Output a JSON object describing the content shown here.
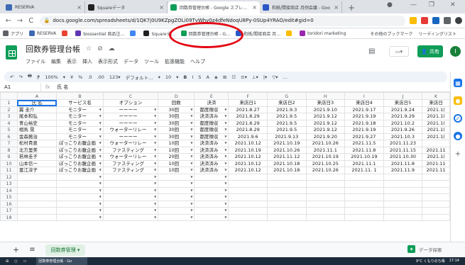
{
  "browser": {
    "tabs": [
      {
        "label": "RESERVA",
        "color": "#3d6ab3"
      },
      {
        "label": "Squareデータ",
        "color": "#222222"
      },
      {
        "label": "回数券管理台帳 - Google スプレッドシート",
        "color": "#0f9d58",
        "active": true
      },
      {
        "label": "和紙/間接商店 月例会議 - Goo",
        "color": "#2a56c6"
      }
    ],
    "new_tab": "+",
    "address": "docs.google.com/spreadsheets/d/1QK7j0U9KZpgZOLi09TvWhv0z4dfeNdoqU8Py-0SUp4YRAO/edit#gid=0",
    "bookmarks": [
      {
        "label": "アプリ",
        "color": "#5f6368"
      },
      {
        "label": "RESERVA",
        "color": "#3d6ab3"
      },
      {
        "label": "",
        "color": "#ea4335"
      },
      {
        "label": "biossentiel 商品注…",
        "color": "#5e35b1"
      },
      {
        "label": "",
        "color": "#4285f4"
      },
      {
        "label": "Squareデ…",
        "color": "#222222"
      },
      {
        "label": "回数券管理台帳 - G…",
        "color": "#0f9d58"
      },
      {
        "label": "和紙/間接商店 月…",
        "color": "#2a56c6"
      },
      {
        "label": "",
        "color": "#fbbc04"
      },
      {
        "label": "toridori marketing",
        "color": "#9c27b0"
      }
    ],
    "bookmarks_right": [
      "その他のブックマーク",
      "リーディングリスト"
    ]
  },
  "doc": {
    "title": "回数券管理台帳",
    "title_icons": [
      "☆",
      "⊘",
      "☁"
    ],
    "menu": [
      "ファイル",
      "編集",
      "表示",
      "挿入",
      "表示形式",
      "データ",
      "ツール",
      "拡張機能",
      "ヘルプ"
    ],
    "share_label": "共有",
    "avatar_letter": "I",
    "present_label": "▭▾"
  },
  "toolbar": {
    "items": [
      "↶",
      "↷",
      "🖶",
      "⁋",
      "100%",
      "▾",
      "¥",
      "%",
      ".0",
      ".00",
      "123▾",
      "デフォルト…",
      "▾",
      "10",
      "▾"
    ],
    "bold": "B",
    "items2": [
      "I",
      "S",
      "A",
      "◈",
      "⊞",
      "☷",
      "≡▾",
      "⊥▾",
      "|▾",
      "▽▾",
      "…"
    ],
    "collapse": "^"
  },
  "formula": {
    "cell_ref": "A1",
    "fx": "fx",
    "content": "氏 名"
  },
  "grid": {
    "columns": [
      "A",
      "B",
      "C",
      "D",
      "E",
      "F",
      "G",
      "H",
      "I",
      "J",
      "K"
    ],
    "rows": [
      [
        "氏 名",
        "サービス名",
        "オプション",
        "回数",
        "決済",
        "来店日1",
        "来店日2",
        "来店日3",
        "来店日4",
        "来店日5",
        "来店日"
      ],
      [
        "翼 圭介",
        "モニター",
        "ーーーー",
        "30回",
        "都度徴収",
        "2021.8.27",
        "2021.9.3",
        "2021.9.10",
        "2021.9.17",
        "2021.9.24",
        "2021.1("
      ],
      [
        "尾本和弘",
        "モニター",
        "ーーーー",
        "30回",
        "決済済み",
        "2021.8.29",
        "2021.9.5",
        "2021.9.12",
        "2021.9.19",
        "2021.9.29",
        "2021.1("
      ],
      [
        "青山裕史",
        "モニター",
        "ーーーー",
        "30回",
        "都度徴収",
        "2021.8.29",
        "2021.9.5",
        "2021.9.12",
        "2021.9.18",
        "2021.10.2",
        "2021.1("
      ],
      [
        "相馬 晃",
        "モニター",
        "ウォーターリレー",
        "30回",
        "都度徴収",
        "2021.8.29",
        "2021.9.5",
        "2021.9.12",
        "2021.9.19",
        "2021.9.26",
        "2021.1("
      ],
      [
        "金森醤治",
        "モニター",
        "ーーーー",
        "30回",
        "都度徴収",
        "2021.9.6",
        "2021.9.13",
        "2021.9.20",
        "2021.9.27",
        "2021.10.3",
        "2021.1("
      ],
      [
        "松村貴恵",
        "ぽっこりお腹企画",
        "ウォーターリレー",
        "10回",
        "決済済み",
        "2021.10.12",
        "2021.10.19",
        "2021.10.26",
        "2021.11.5",
        "2021.11.23",
        ""
      ],
      [
        "北方里美",
        "ぽっこりお腹企画",
        "ファスティング",
        "10回",
        "決済済み",
        "2021.10.19",
        "2021.10.26",
        "2021.11.1",
        "2021.11.8",
        "2021.11.15",
        "2021.11"
      ],
      [
        "若林圭子",
        "ぽっこりお腹企画",
        "ウォーターリレー",
        "20回",
        "決済済み",
        "2021.10.12",
        "2021.11.12",
        "2021.10.19",
        "2021.10.19",
        "2021.10.30",
        "2021.1("
      ],
      [
        "山本信一",
        "ぽっこりお腹企画",
        "ファスティング",
        "10回",
        "決済済み",
        "2021.10.12",
        "2021.10.18",
        "2021.10.25",
        "2021.11.1",
        "2021.11.8",
        "2021.11"
      ],
      [
        "富江淳子",
        "ぽっこりお腹企画",
        "ファスティング",
        "10回",
        "決済済み",
        "2021.10.12",
        "2021.10.18",
        "2021.10.26",
        "2021.11. 1",
        "2021.11.9",
        "2021.11"
      ]
    ],
    "total_rows": 18
  },
  "sheets": {
    "add": "+",
    "list": "≡",
    "active_tab": "回数券管理 ▾",
    "explore": "データ探索",
    "explore_icon": "✦"
  },
  "taskbar": {
    "app": "回数券管理台帳 - Go",
    "weather": "9°C くもりのち晴",
    "time": "17:14"
  },
  "annotation": {
    "color": "#e30613"
  }
}
